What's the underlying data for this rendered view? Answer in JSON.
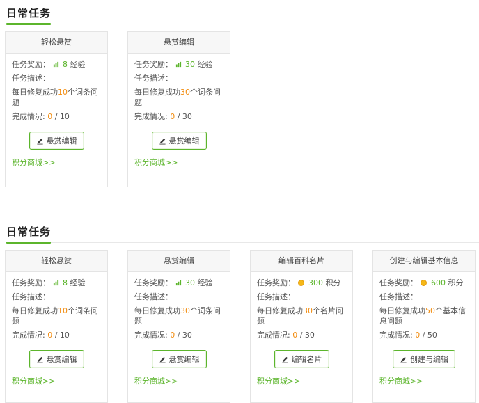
{
  "sections": [
    {
      "title": "日常任务",
      "cards": [
        {
          "name": "轻松悬赏",
          "reward_label": "任务奖励：",
          "reward_icon": "exp-icon",
          "reward_value": "8",
          "reward_unit": "经验",
          "desc_label": "任务描述：",
          "desc_pre": "每日修复成功",
          "desc_num": "10",
          "desc_post": "个词条问题",
          "progress_label": "完成情况:",
          "progress_done": "0",
          "progress_total": "/ 10",
          "button": "悬赏编辑",
          "shop": "积分商城>>"
        },
        {
          "name": "悬赏编辑",
          "reward_label": "任务奖励：",
          "reward_icon": "exp-icon",
          "reward_value": "30",
          "reward_unit": "经验",
          "desc_label": "任务描述：",
          "desc_pre": "每日修复成功",
          "desc_num": "30",
          "desc_post": "个词条问题",
          "progress_label": "完成情况:",
          "progress_done": "0",
          "progress_total": "/ 30",
          "button": "悬赏编辑",
          "shop": "积分商城>>"
        }
      ]
    },
    {
      "title": "日常任务",
      "cards": [
        {
          "name": "轻松悬赏",
          "reward_label": "任务奖励：",
          "reward_icon": "exp-icon",
          "reward_value": "8",
          "reward_unit": "经验",
          "desc_label": "任务描述：",
          "desc_pre": "每日修复成功",
          "desc_num": "10",
          "desc_post": "个词条问题",
          "progress_label": "完成情况:",
          "progress_done": "0",
          "progress_total": "/ 10",
          "button": "悬赏编辑",
          "shop": "积分商城>>"
        },
        {
          "name": "悬赏编辑",
          "reward_label": "任务奖励：",
          "reward_icon": "exp-icon",
          "reward_value": "30",
          "reward_unit": "经验",
          "desc_label": "任务描述：",
          "desc_pre": "每日修复成功",
          "desc_num": "30",
          "desc_post": "个词条问题",
          "progress_label": "完成情况:",
          "progress_done": "0",
          "progress_total": "/ 30",
          "button": "悬赏编辑",
          "shop": "积分商城>>"
        },
        {
          "name": "编辑百科名片",
          "reward_label": "任务奖励：",
          "reward_icon": "coin-icon",
          "reward_value": "300",
          "reward_unit": "积分",
          "desc_label": "任务描述：",
          "desc_pre": "每日修复成功",
          "desc_num": "30",
          "desc_post": "个名片问题",
          "progress_label": "完成情况:",
          "progress_done": "0",
          "progress_total": "/ 30",
          "button": "编辑名片",
          "shop": "积分商城>>"
        },
        {
          "name": "创建与编辑基本信息",
          "reward_label": "任务奖励：",
          "reward_icon": "coin-icon",
          "reward_value": "600",
          "reward_unit": "积分",
          "desc_label": "任务描述：",
          "desc_pre": "每日修复成功",
          "desc_num": "50",
          "desc_post": "个基本信息问题",
          "progress_label": "完成情况:",
          "progress_done": "0",
          "progress_total": "/ 50",
          "button": "创建与编辑",
          "shop": "积分商城>>"
        }
      ]
    }
  ],
  "colors": {
    "accent": "#5cb52c",
    "number": "#f28c0f",
    "coin": "#f5b818"
  }
}
